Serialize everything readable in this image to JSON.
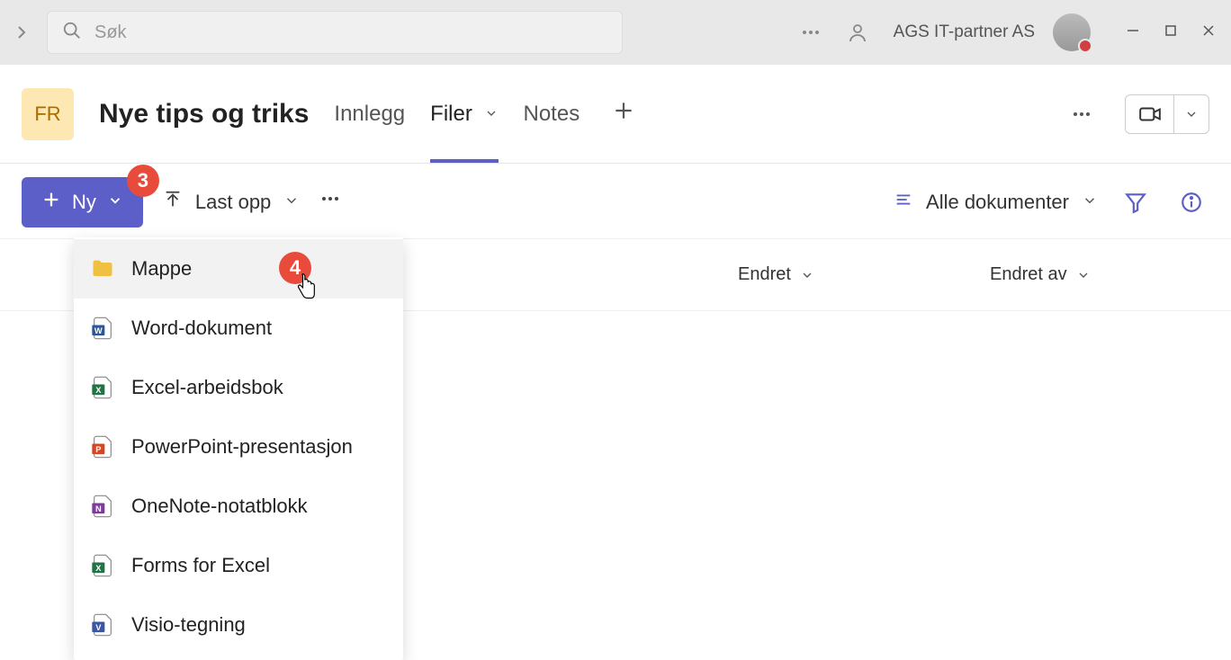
{
  "topbar": {
    "search_placeholder": "Søk",
    "org_name": "AGS IT-partner AS"
  },
  "channel": {
    "avatar_initials": "FR",
    "title": "Nye tips og triks",
    "tabs": {
      "posts": "Innlegg",
      "files": "Filer",
      "notes": "Notes"
    }
  },
  "toolbar": {
    "new_label": "Ny",
    "upload_label": "Last opp",
    "view_label": "Alle dokumenter"
  },
  "annotations": {
    "badge3": "3",
    "badge4": "4"
  },
  "dropdown": {
    "items": [
      {
        "label": "Mappe",
        "icon": "folder"
      },
      {
        "label": "Word-dokument",
        "icon": "word"
      },
      {
        "label": "Excel-arbeidsbok",
        "icon": "excel"
      },
      {
        "label": "PowerPoint-presentasjon",
        "icon": "powerpoint"
      },
      {
        "label": "OneNote-notatblokk",
        "icon": "onenote"
      },
      {
        "label": "Forms for Excel",
        "icon": "excel"
      },
      {
        "label": "Visio-tegning",
        "icon": "visio"
      }
    ]
  },
  "columns": {
    "modified": "Endret",
    "modified_by": "Endret av"
  }
}
